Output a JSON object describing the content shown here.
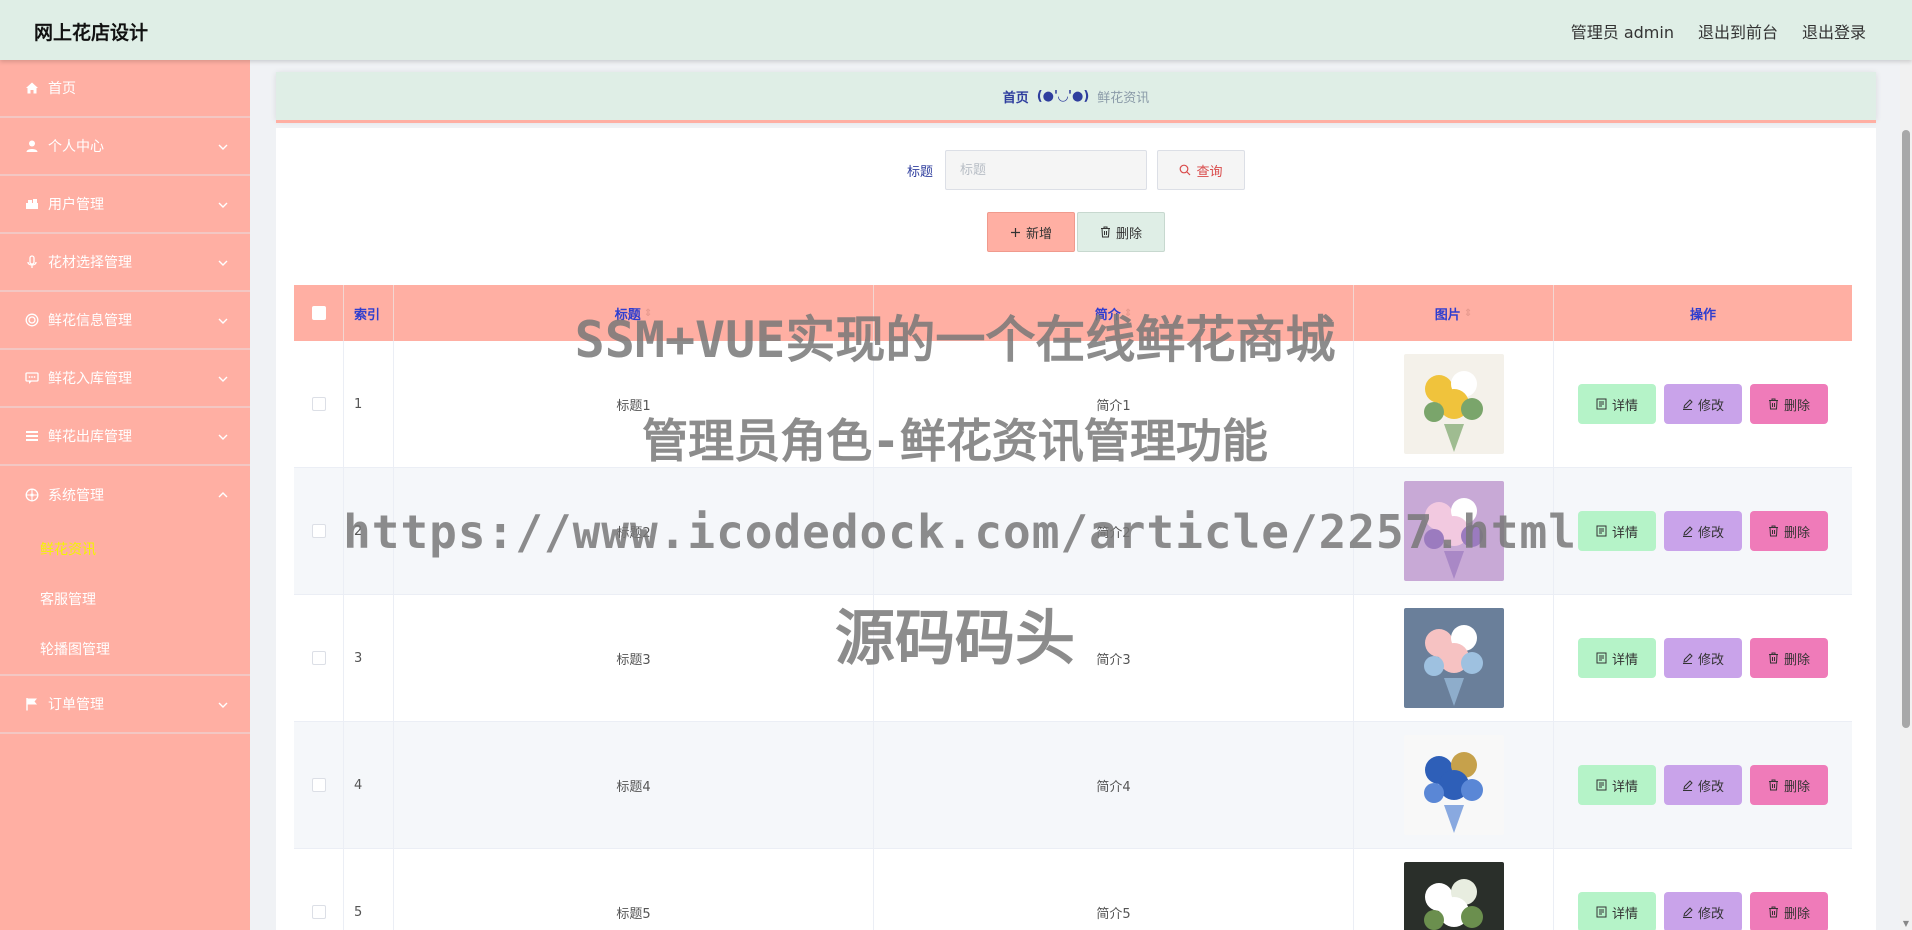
{
  "app": {
    "title": "网上花店设计"
  },
  "header": {
    "user_label": "管理员 admin",
    "to_front": "退出到前台",
    "logout": "退出登录"
  },
  "sidebar": {
    "items": [
      {
        "label": "首页",
        "icon": "home-icon",
        "expandable": false
      },
      {
        "label": "个人中心",
        "icon": "person-icon",
        "expandable": true
      },
      {
        "label": "用户管理",
        "icon": "users-icon",
        "expandable": true
      },
      {
        "label": "花材选择管理",
        "icon": "mic-icon",
        "expandable": true
      },
      {
        "label": "鲜花信息管理",
        "icon": "target-icon",
        "expandable": true
      },
      {
        "label": "鲜花入库管理",
        "icon": "chat-icon",
        "expandable": true
      },
      {
        "label": "鲜花出库管理",
        "icon": "list-icon",
        "expandable": true
      },
      {
        "label": "系统管理",
        "icon": "settings-icon",
        "expandable": true,
        "expanded": true,
        "children": [
          {
            "label": "鲜花资讯",
            "active": true
          },
          {
            "label": "客服管理"
          },
          {
            "label": "轮播图管理"
          }
        ]
      },
      {
        "label": "订单管理",
        "icon": "flag-icon",
        "expandable": true
      }
    ]
  },
  "breadcrumb": {
    "home": "首页",
    "separator": "(●'◡'●)",
    "current": "鲜花资讯"
  },
  "search": {
    "label": "标题",
    "placeholder": "标题",
    "query_button": "查询"
  },
  "actions": {
    "add_button": "新增",
    "delete_button": "删除"
  },
  "table": {
    "headers": {
      "index": "索引",
      "title": "标题",
      "intro": "简介",
      "picture": "图片",
      "operation": "操作"
    },
    "op_labels": {
      "detail": "详情",
      "edit": "修改",
      "delete": "删除"
    },
    "rows": [
      {
        "index": "1",
        "title": "标题1",
        "intro": "简介1"
      },
      {
        "index": "2",
        "title": "标题2",
        "intro": "简介2"
      },
      {
        "index": "3",
        "title": "标题3",
        "intro": "简介3"
      },
      {
        "index": "4",
        "title": "标题4",
        "intro": "简介4"
      },
      {
        "index": "5",
        "title": "标题5",
        "intro": "简介5"
      }
    ]
  },
  "watermark": {
    "line1": "SSM+VUE实现的一个在线鲜花商城",
    "line2": "管理员角色-鲜花资讯管理功能",
    "line3": "https://www.icodedock.com/article/2257.html",
    "line4": "源码码头"
  },
  "colors": {
    "header_bg": "#dfeee6",
    "sidebar_bg": "#ffafa3",
    "accent_blue": "#2f3ecf",
    "active_sub": "#f3f500"
  }
}
